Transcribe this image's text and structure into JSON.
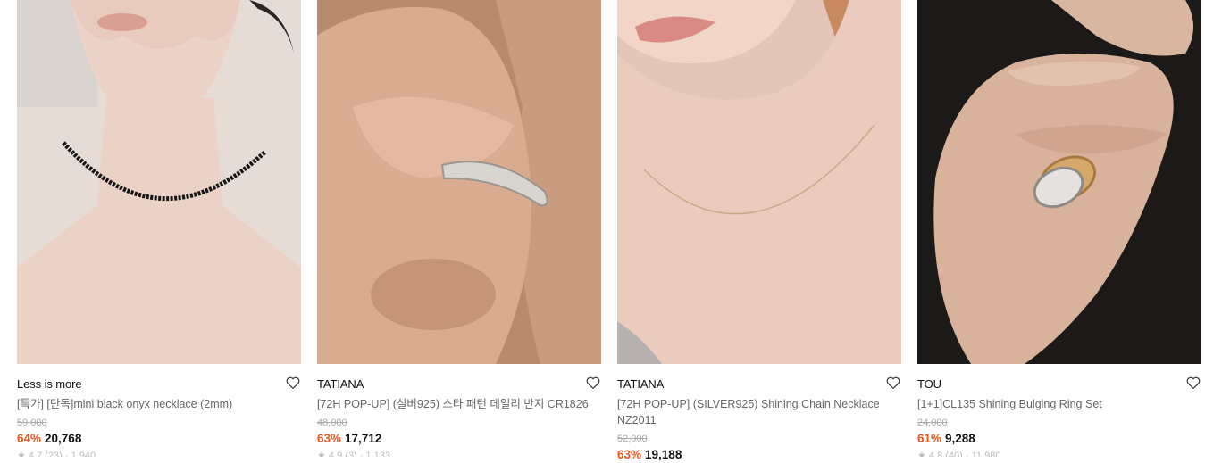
{
  "products": [
    {
      "brand": "Less is more",
      "name": "[특가] [단독]mini black onyx necklace (2mm)",
      "original_price": "59,000",
      "discount": "64%",
      "price": "20,768",
      "meta": "★ 4.7 (23) · 1,940"
    },
    {
      "brand": "TATIANA",
      "name": "[72H POP-UP] (실버925) 스타 패턴 데일리 반지 CR1826",
      "original_price": "48,000",
      "discount": "63%",
      "price": "17,712",
      "meta": "★ 4.9 (3) · 1,133"
    },
    {
      "brand": "TATIANA",
      "name": "[72H POP-UP] (SILVER925) Shining Chain Necklace NZ2011",
      "original_price": "52,000",
      "discount": "63%",
      "price": "19,188",
      "meta": ""
    },
    {
      "brand": "TOU",
      "name": "[1+1]CL135 Shining Bulging Ring Set",
      "original_price": "24,000",
      "discount": "61%",
      "price": "9,288",
      "meta": "★ 4.8 (40) · 11,980"
    }
  ],
  "colors": {
    "discount": "#e8561e",
    "original_price": "#aaaaaa"
  }
}
